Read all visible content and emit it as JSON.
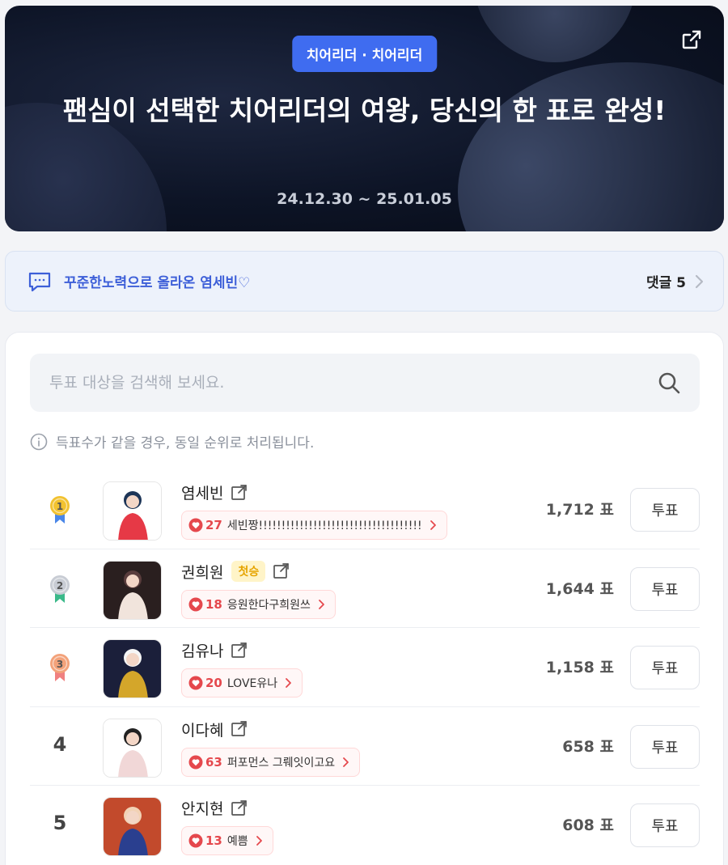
{
  "hero": {
    "badge": "치어리더 · 치어리더",
    "title": "팬심이 선택한 치어리더의 여왕, 당신의 한 표로 완성!",
    "period": "24.12.30 ~ 25.01.05"
  },
  "comment_bar": {
    "text": "꾸준한노력으로 올라온 염세빈♡",
    "count_label": "댓글 5"
  },
  "search": {
    "placeholder": "투표 대상을 검색해 보세요."
  },
  "notice": "득표수가 같을 경우, 동일 순위로 처리됩니다.",
  "vote_label": "투표",
  "colors": {
    "accent": "#3f6cf0",
    "heart": "#e5484d",
    "gold": "#f2c230",
    "silver": "#c8ccd4",
    "bronze": "#f3a27a",
    "first_tag_bg": "#fff4c8"
  },
  "candidates": [
    {
      "rank": "1",
      "medal": "gold",
      "name": "염세빈",
      "first_tag": "",
      "cheer_count": "27",
      "cheer_msg": "세빈짱!!!!!!!!!!!!!!!!!!!!!!!!!!!!!!!!!!!!",
      "votes": "1,712 표"
    },
    {
      "rank": "2",
      "medal": "silver",
      "name": "권희원",
      "first_tag": "첫승",
      "cheer_count": "18",
      "cheer_msg": "응원한다구희원쓰",
      "votes": "1,644 표"
    },
    {
      "rank": "3",
      "medal": "bronze",
      "name": "김유나",
      "first_tag": "",
      "cheer_count": "20",
      "cheer_msg": "LOVE유나",
      "votes": "1,158 표"
    },
    {
      "rank": "4",
      "medal": "",
      "name": "이다혜",
      "first_tag": "",
      "cheer_count": "63",
      "cheer_msg": "퍼포먼스 그뤠잇이고요",
      "votes": "658 표"
    },
    {
      "rank": "5",
      "medal": "",
      "name": "안지현",
      "first_tag": "",
      "cheer_count": "13",
      "cheer_msg": "예쁨",
      "votes": "608 표"
    }
  ]
}
